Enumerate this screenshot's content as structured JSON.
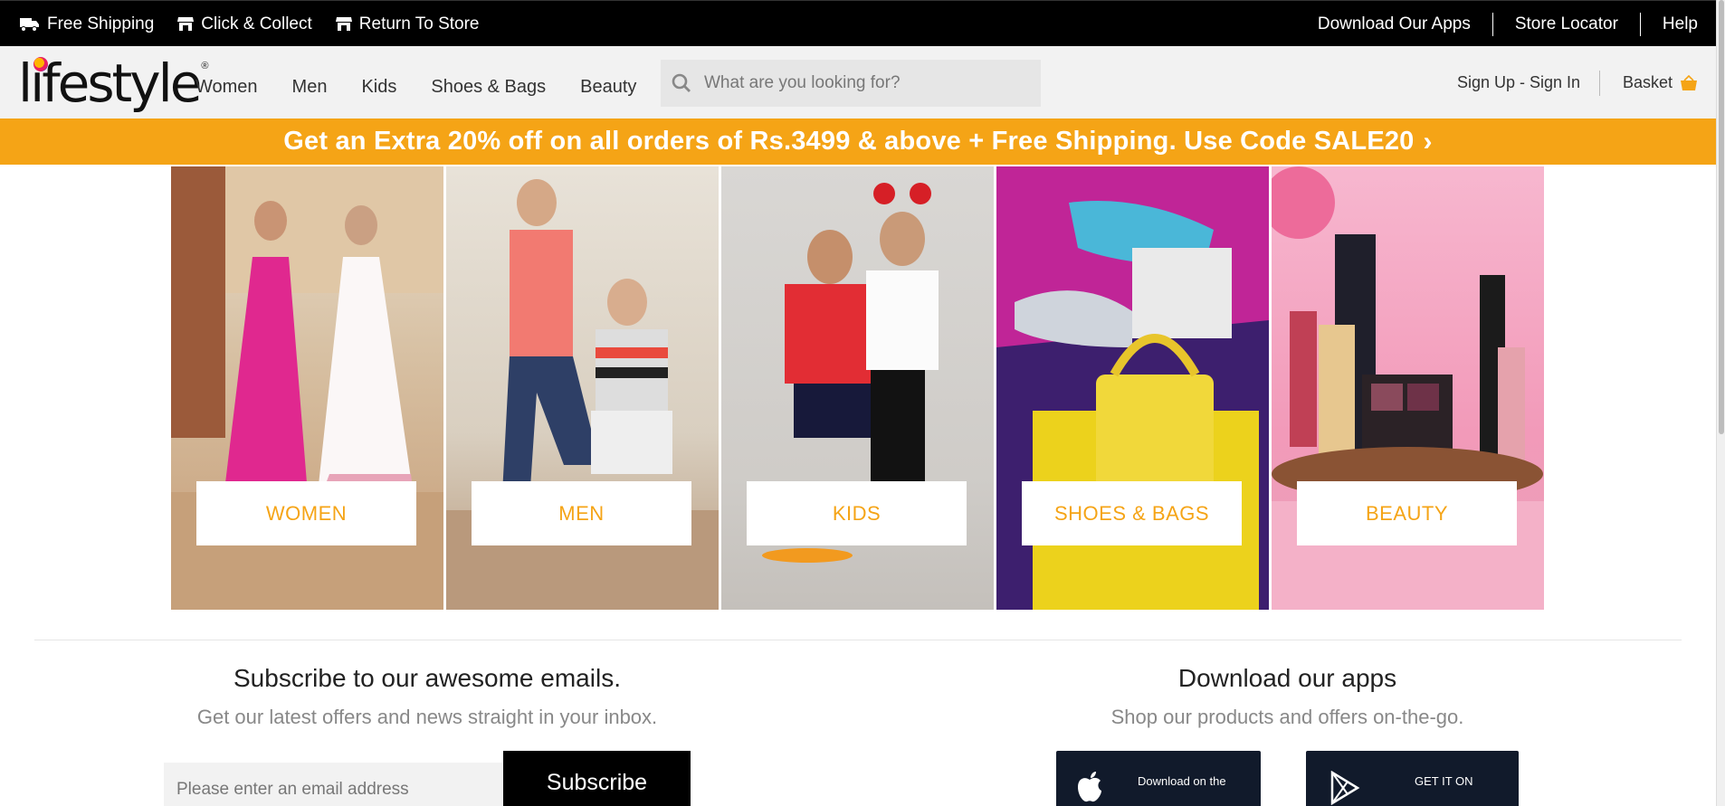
{
  "topbar": {
    "left": [
      {
        "label": "Free Shipping",
        "icon": "truck-icon"
      },
      {
        "label": "Click & Collect",
        "icon": "store-icon"
      },
      {
        "label": "Return To Store",
        "icon": "store-icon"
      }
    ],
    "right": [
      "Download Our Apps",
      "Store Locator",
      "Help"
    ]
  },
  "header": {
    "logo": "lifestyle",
    "nav": [
      "Women",
      "Men",
      "Kids",
      "Shoes & Bags",
      "Beauty"
    ],
    "search_placeholder": "What are you looking for?",
    "account": "Sign Up - Sign In",
    "basket": "Basket"
  },
  "promo": {
    "text": "Get an Extra 20% off on all orders of Rs.3499 & above + Free Shipping. Use Code SALE20",
    "color": "#f5a416"
  },
  "categories": [
    "WOMEN",
    "MEN",
    "KIDS",
    "SHOES & BAGS",
    "BEAUTY"
  ],
  "subscribe": {
    "title": "Subscribe to our awesome emails.",
    "description": "Get our latest offers and news straight in your inbox.",
    "email_placeholder": "Please enter an email address",
    "button": "Subscribe"
  },
  "apps": {
    "title": "Download our apps",
    "description": "Shop our products and offers on-the-go.",
    "apple_small": "Download on the",
    "google_small": "GET IT ON"
  }
}
